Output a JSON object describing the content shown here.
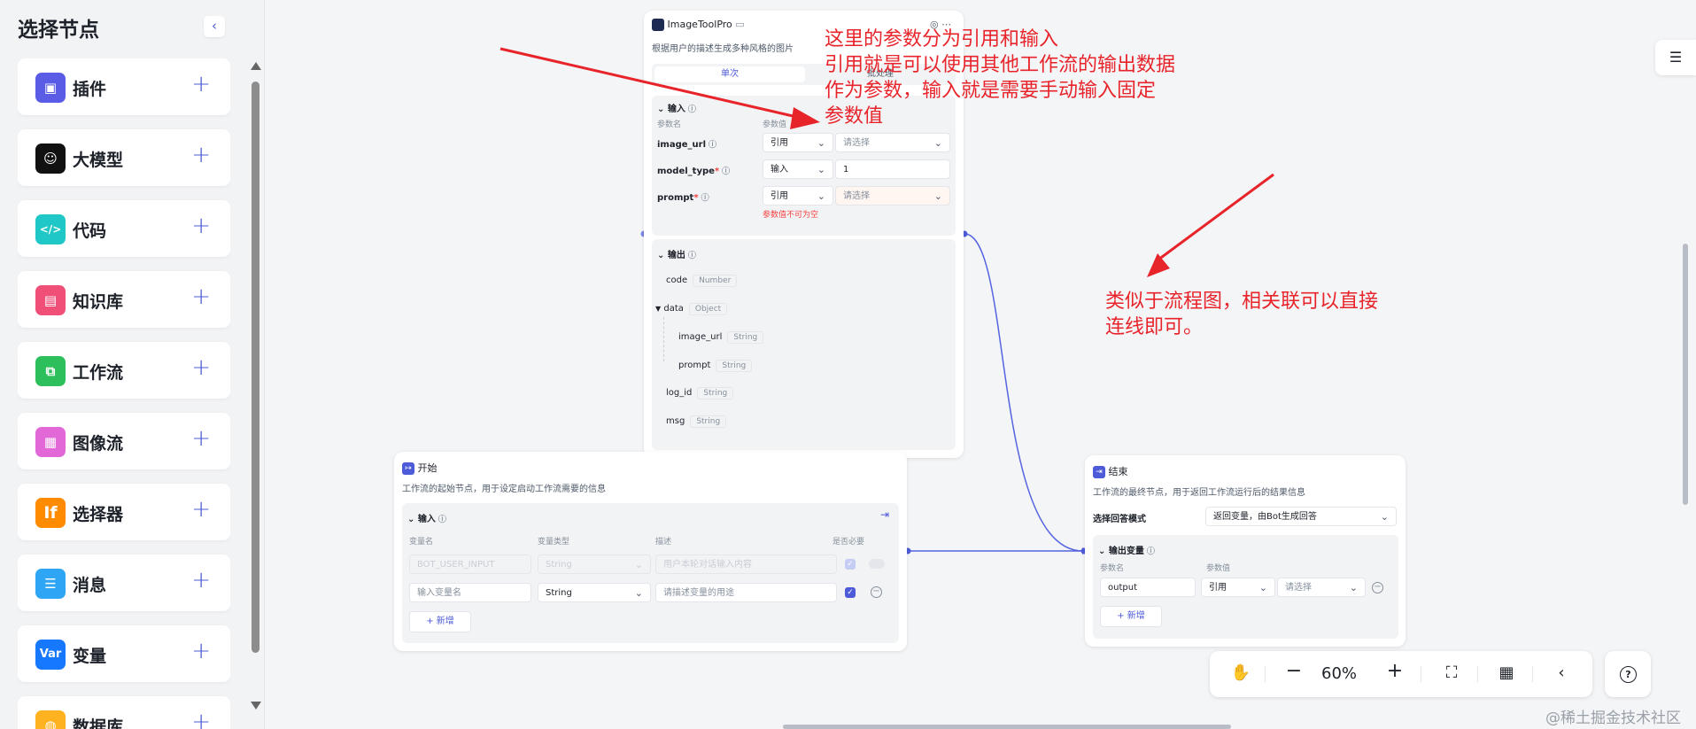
{
  "sidebar": {
    "title": "选择节点",
    "collapse_icon": "chevron-left-icon",
    "items": [
      {
        "label": "插件",
        "icon": "cube-icon",
        "color": "#5b5ce6",
        "glyph": "▣"
      },
      {
        "label": "大模型",
        "icon": "llm-face-icon",
        "color": "#111111",
        "glyph": "☺"
      },
      {
        "label": "代码",
        "icon": "code-icon",
        "color": "#1fc8c6",
        "glyph": "</>"
      },
      {
        "label": "知识库",
        "icon": "knowledge-icon",
        "color": "#f04f78",
        "glyph": "▤"
      },
      {
        "label": "工作流",
        "icon": "workflow-icon",
        "color": "#2cbf5b",
        "glyph": "⧉"
      },
      {
        "label": "图像流",
        "icon": "imageflow-icon",
        "color": "#e267d7",
        "glyph": "▦"
      },
      {
        "label": "选择器",
        "icon": "condition-icon",
        "color": "#ff8c00",
        "glyph": "If"
      },
      {
        "label": "消息",
        "icon": "message-icon",
        "color": "#2ea6f5",
        "glyph": "☰"
      },
      {
        "label": "变量",
        "icon": "variable-icon",
        "color": "#1677ff",
        "glyph": "Var"
      },
      {
        "label": "数据库",
        "icon": "database-icon",
        "color": "#ffb21f",
        "glyph": "◍"
      }
    ]
  },
  "image_node": {
    "title": "ImageToolPro",
    "description": "根据用户的描述生成多种风格的图片",
    "tabs": [
      "单次",
      "批处理"
    ],
    "input_section": {
      "label": "输入",
      "col_name": "参数名",
      "col_value": "参数值",
      "rows": [
        {
          "name": "image_url",
          "required": "",
          "mode": "引用",
          "value": "请选择"
        },
        {
          "name": "model_type",
          "required": "*",
          "mode": "输入",
          "value": "1"
        },
        {
          "name": "prompt",
          "required": "*",
          "mode": "引用",
          "value": "请选择"
        }
      ],
      "error": "参数值不可为空"
    },
    "output_section": {
      "label": "输出",
      "rows": [
        {
          "name": "code",
          "type": "Number"
        },
        {
          "name": "data",
          "type": "Object"
        },
        {
          "name": "image_url",
          "type": "String"
        },
        {
          "name": "prompt",
          "type": "String"
        },
        {
          "name": "log_id",
          "type": "String"
        },
        {
          "name": "msg",
          "type": "String"
        }
      ]
    }
  },
  "start_node": {
    "title": "开始",
    "description": "工作流的起始节点，用于设定启动工作流需要的信息",
    "input_label": "输入",
    "headers": [
      "变量名",
      "变量类型",
      "描述",
      "是否必要"
    ],
    "rows": [
      {
        "name": "BOT_USER_INPUT",
        "type": "String",
        "desc": "用户本轮对话输入内容"
      },
      {
        "name": "输入变量名",
        "type": "String",
        "desc": "请描述变量的用途"
      }
    ],
    "add_label": "新增"
  },
  "end_node": {
    "title": "结束",
    "description": "工作流的最终节点，用于返回工作流运行后的结果信息",
    "mode_label": "选择回答模式",
    "mode_value": "返回变量，由Bot生成回答",
    "output_label": "输出变量",
    "col_name": "参数名",
    "col_value": "参数值",
    "row": {
      "name": "output",
      "mode": "引用",
      "value": "请选择"
    },
    "add_label": "新增"
  },
  "annotations": {
    "top": [
      "这里的参数分为引用和输入",
      "引用就是可以使用其他工作流的输出数据",
      "作为参数，输入就是需要手动输入固定",
      "参数值"
    ],
    "right": [
      "类似于流程图，相关联可以直接",
      "连线即可。"
    ]
  },
  "toolbar": {
    "zoom": "60%",
    "icons": [
      "hand-icon",
      "zoom-out-icon",
      "zoom-in-icon",
      "fit-view-icon",
      "layout-icon",
      "back-icon",
      "help-icon"
    ]
  },
  "watermark": "@稀土掘金技术社区",
  "colors": {
    "accent": "#4e5bd8",
    "annotation": "#e8242b",
    "edge": "#5564e0"
  }
}
